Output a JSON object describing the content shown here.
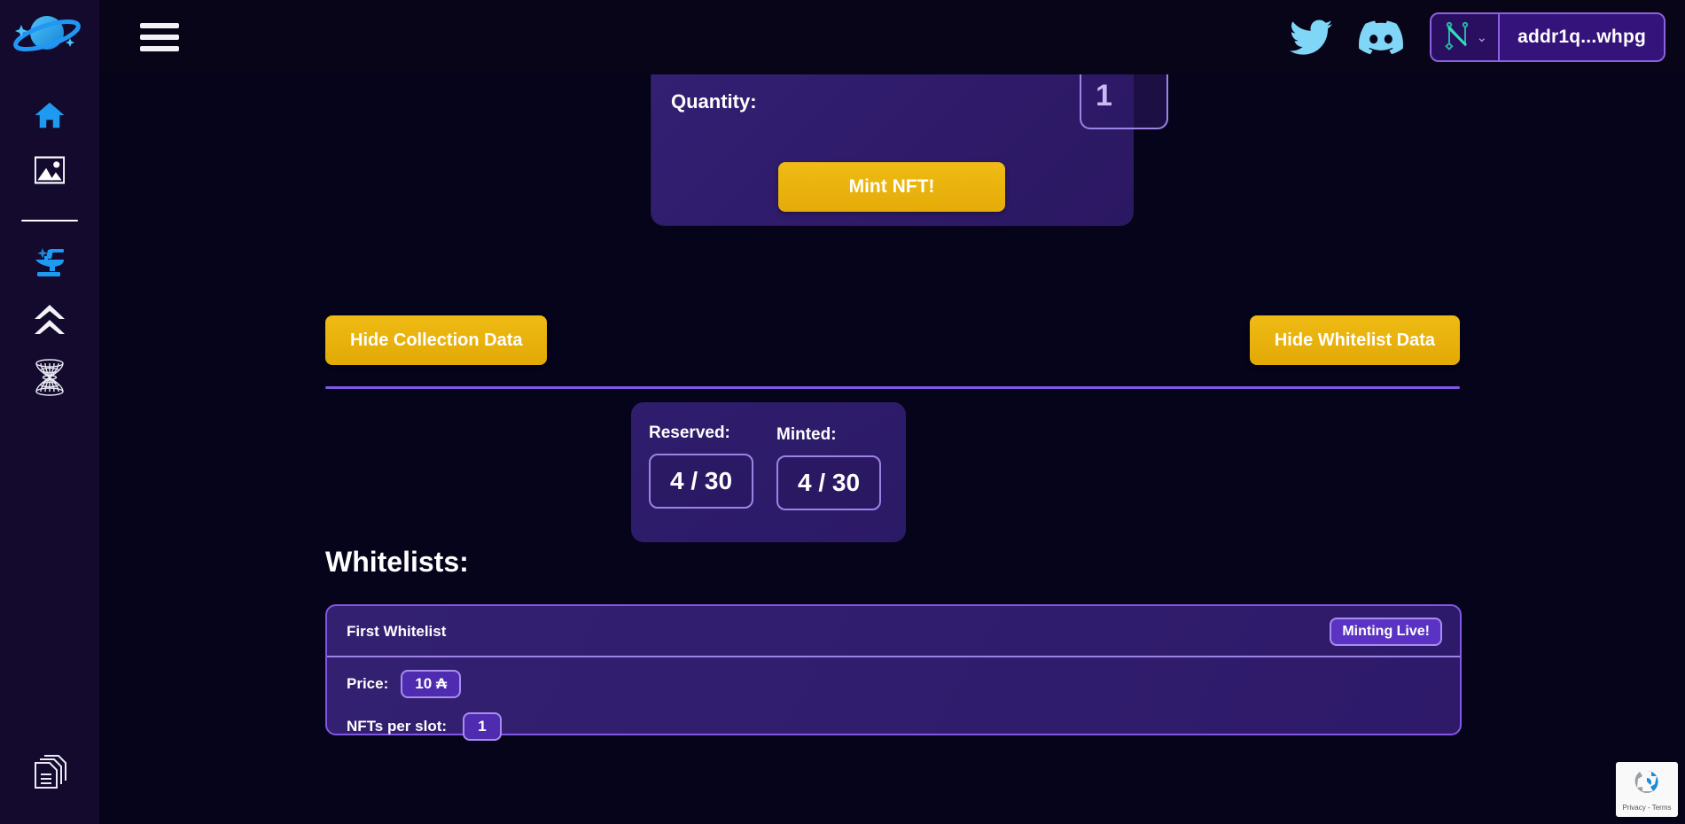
{
  "sidebar": {
    "logo_name": "planet-logo",
    "items": [
      {
        "icon": "home-icon",
        "label": "Home"
      },
      {
        "icon": "gallery-icon",
        "label": "Gallery"
      },
      {
        "icon": "anvil-icon",
        "label": "Forge"
      },
      {
        "icon": "double-chevron-up-icon",
        "label": "Upgrade"
      },
      {
        "icon": "wormhole-icon",
        "label": "Wormhole"
      },
      {
        "icon": "documents-icon",
        "label": "Docs"
      }
    ]
  },
  "topbar": {
    "menu_icon": "hamburger-icon",
    "twitter_icon": "twitter-icon",
    "discord_icon": "discord-icon",
    "wallet": {
      "wallet_icon": "nami-wallet-icon",
      "chevron": "⌄",
      "address": "addr1q...whpg"
    }
  },
  "mint": {
    "quantity_label": "Quantity:",
    "quantity_value": "1",
    "mint_button": "Mint NFT!"
  },
  "toggles": {
    "collection": "Hide Collection Data",
    "whitelist": "Hide Whitelist Data"
  },
  "stats": {
    "reserved_label": "Reserved:",
    "reserved_value": "4 / 30",
    "minted_label": "Minted:",
    "minted_value": "4 / 30"
  },
  "whitelists": {
    "heading": "Whitelists:",
    "entries": [
      {
        "name": "First Whitelist",
        "status": "Minting Live!",
        "price_label": "Price:",
        "price_value": "10 ₳",
        "slots_label": "NFTs per slot:",
        "slots_value": "1"
      }
    ]
  },
  "recaptcha": {
    "text": "Privacy - Terms"
  },
  "colors": {
    "background": "#06041a",
    "sidebar": "#130a2e",
    "accent_gold": "#efbb14",
    "accent_purple": "#8257e6",
    "icon_blue": "#29a8f0",
    "wallet_teal": "#23b5a0"
  }
}
